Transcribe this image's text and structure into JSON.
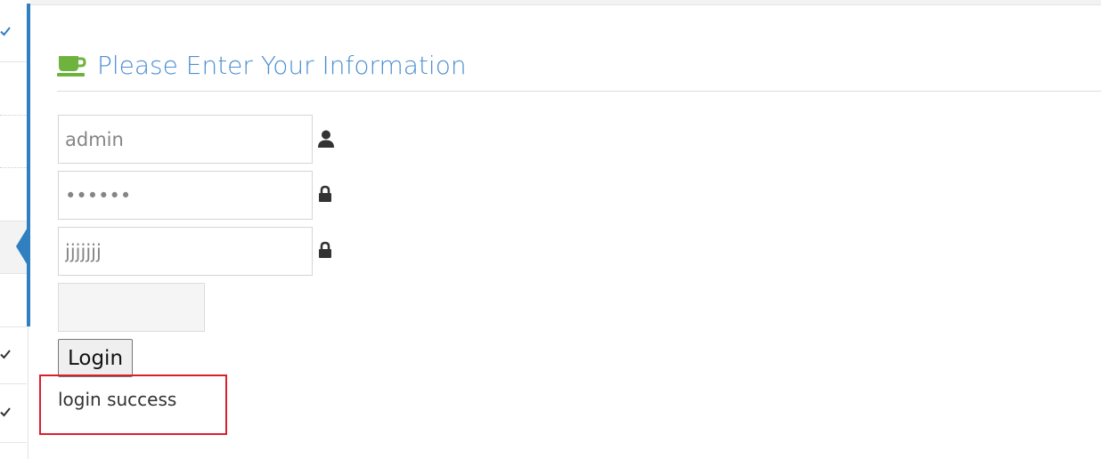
{
  "sidebar": {
    "check_icon_color": "#2f7fc1",
    "active_indicator_color": "#2f7fc1"
  },
  "form": {
    "title": "Please Enter Your Information",
    "title_icon": "coffee-cup-icon",
    "title_color": "#4d8fd1",
    "icon_color": "#6fb33f",
    "username": {
      "value": "admin",
      "icon": "user-icon"
    },
    "password": {
      "value": "••••••",
      "icon": "lock-icon"
    },
    "extra_field": {
      "value": "jjjjjjj",
      "icon": "lock-icon"
    },
    "login_label": "Login"
  },
  "result": {
    "message": "login success",
    "highlight_color": "#d9202f"
  }
}
